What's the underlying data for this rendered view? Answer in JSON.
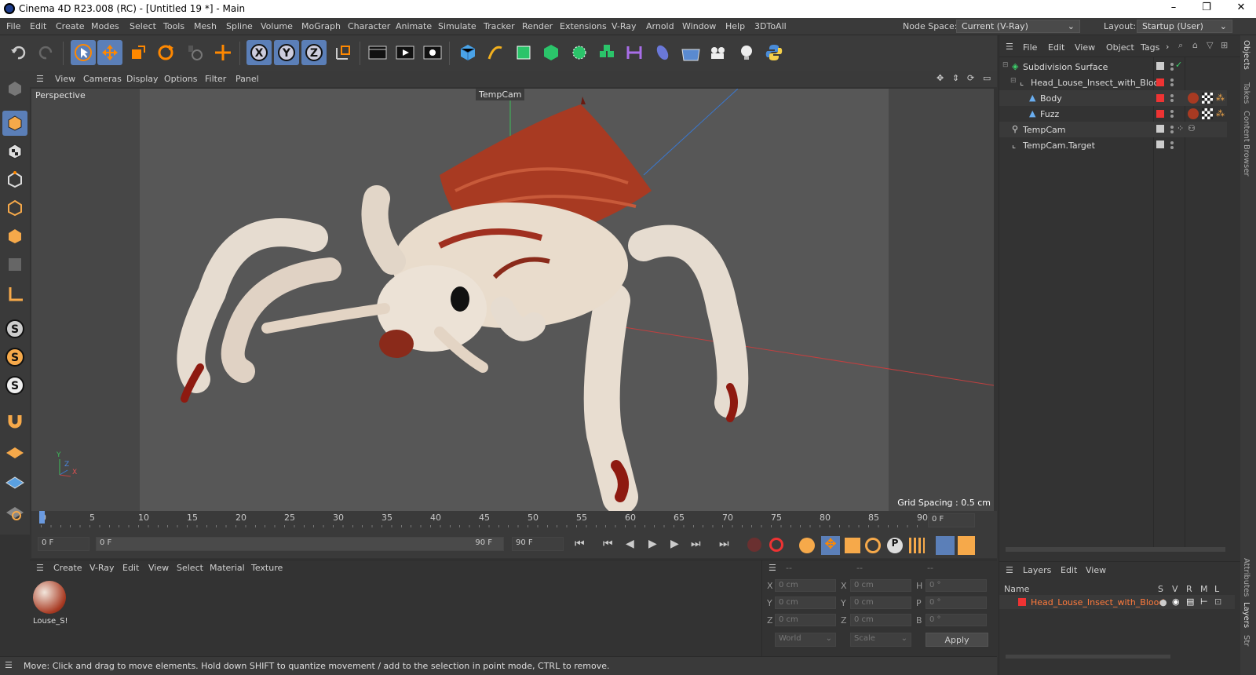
{
  "window": {
    "title": "Cinema 4D R23.008 (RC) - [Untitled 19 *] - Main",
    "buttons": [
      "–",
      "❐",
      "✕"
    ]
  },
  "menubar": {
    "items": [
      "File",
      "Edit",
      "Create",
      "Modes",
      "Select",
      "Tools",
      "Mesh",
      "Spline",
      "Volume",
      "MoGraph",
      "Character",
      "Animate",
      "Simulate",
      "Tracker",
      "Render",
      "Extensions",
      "V-Ray",
      "Arnold",
      "Window",
      "Help",
      "3DToAll"
    ],
    "node_space_label": "Node Space:",
    "node_space_value": "Current (V-Ray)",
    "layout_label": "Layout:",
    "layout_value": "Startup (User)"
  },
  "viewport_menu": [
    "View",
    "Cameras",
    "Display",
    "Options",
    "Filter",
    "Panel"
  ],
  "viewport": {
    "label": "Perspective",
    "camera_label": "TempCam",
    "grid_spacing": "Grid Spacing : 0.5 cm",
    "axis_y": "Y",
    "axis_z": "Z",
    "axis_x": "X"
  },
  "timeline": {
    "ticks": [
      "0",
      "5",
      "10",
      "15",
      "20",
      "25",
      "30",
      "35",
      "40",
      "45",
      "50",
      "55",
      "60",
      "65",
      "70",
      "75",
      "80",
      "85",
      "90"
    ],
    "current_frame": "0 F"
  },
  "playbar": {
    "start_frame": "0 F",
    "range_start": "0 F",
    "range_end": "90 F",
    "end_frame": "90 F"
  },
  "material_menu": [
    "Create",
    "V-Ray",
    "Edit",
    "View",
    "Select",
    "Material",
    "Texture"
  ],
  "material": {
    "name": "Louse_S!"
  },
  "coords": {
    "headers": [
      "--",
      "--",
      "--"
    ],
    "rows": [
      {
        "a": "X",
        "av": "0 cm",
        "b": "X",
        "bv": "0 cm",
        "c": "H",
        "cv": "0 °"
      },
      {
        "a": "Y",
        "av": "0 cm",
        "b": "Y",
        "bv": "0 cm",
        "c": "P",
        "cv": "0 °"
      },
      {
        "a": "Z",
        "av": "0 cm",
        "b": "Z",
        "bv": "0 cm",
        "c": "B",
        "cv": "0 °"
      }
    ],
    "mode1": "World",
    "mode2": "Scale",
    "apply": "Apply"
  },
  "status": "Move: Click and drag to move elements. Hold down SHIFT to quantize movement / add to the selection in point mode, CTRL to remove.",
  "objects_menu": [
    "File",
    "Edit",
    "View",
    "Object",
    "Tags"
  ],
  "objects": [
    {
      "name": "Subdivision Surface"
    },
    {
      "name": "Head_Louse_Insect_with_Blood"
    },
    {
      "name": "Body"
    },
    {
      "name": "Fuzz"
    },
    {
      "name": "TempCam"
    },
    {
      "name": "TempCam.Target"
    }
  ],
  "layers_menu": [
    "Layers",
    "Edit",
    "View"
  ],
  "layers": {
    "col_name": "Name",
    "cols": [
      "S",
      "V",
      "R",
      "M",
      "L"
    ],
    "row": "Head_Louse_Insect_with_Blood"
  },
  "right_tabs": [
    "Objects",
    "Takes",
    "Content Browser",
    "Attributes",
    "Layers",
    "Str"
  ],
  "colors": {
    "accent": "#5b7fb8",
    "layer_text": "#ff7a3c",
    "tag_red": "#e33"
  }
}
